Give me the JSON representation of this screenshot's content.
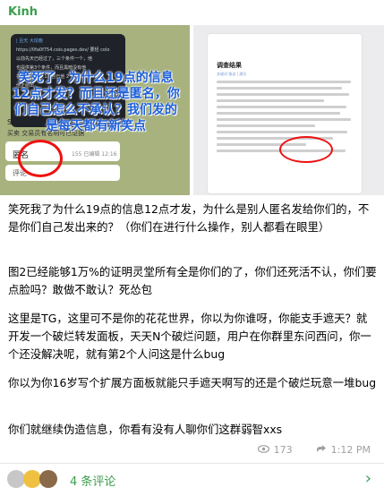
{
  "sender": {
    "name": "Kinh"
  },
  "left_shot": {
    "link_title": "| 且无 大炫瘾",
    "url": "https://0fa0f754.cois.pages.dev/ 要轻 colo",
    "bubble_line1": "以前先天已经过了，三个条件一个，他",
    "bubble_line2": "也提供第3个条件，而且黑暗没有他",
    "bubble_line3": "在下面一个 2.11 自已他 2",
    "bubble_line4": "他正给出",
    "overlay": "笑死了，为什么19点的信息12点才发？而且还是匿名，你们自己怎么不承认？我们发的是每天都有新笑点",
    "scq": "Scqc",
    "sub": "买卖 交易员有名明可已证据",
    "anon": "匿名",
    "views": "155 已编辑 12:16",
    "comment": "评论"
  },
  "right_shot": {
    "title": "调查结果",
    "meta": "关键词 推送 | 通讯"
  },
  "message": {
    "p1": "笑死我了为什么19点的信息12点才发，为什么是别人匿名发给你们的，不是你们自己发出来的？（你们在进行什么操作，别人都看在眼里）",
    "p2": "图2已经能够1万%的证明灵堂所有全是你们的了，你们还死活不认，你们要点脸吗？敢做不敢认？死怂包",
    "p3": "这里是TG，这里可不是你的花花世界，你以为你谁呀，你能支手遮天？就开发一个破烂转发面板，天天N个破烂问题，用户在你群里东问西问，你一个还没解决呢，就有第2个人问这是什么bug",
    "p4": "你以为你16岁写个扩展方面板就能只手遮天啊写的还是个破烂玩意一堆bug",
    "p5": "你们就继续伪造信息，你看有没有人聊你们这群弱智xxs"
  },
  "meta": {
    "views": "173",
    "time": "1:12 PM"
  },
  "comments": {
    "label": "4 条评论"
  },
  "colors": {
    "accent": "#3d9e4f",
    "annotation": "#e11111",
    "overlay_text": "#1e5fd9"
  },
  "icons": [
    "eye-icon",
    "share-icon",
    "chevron-right-icon",
    "chat-icon"
  ]
}
